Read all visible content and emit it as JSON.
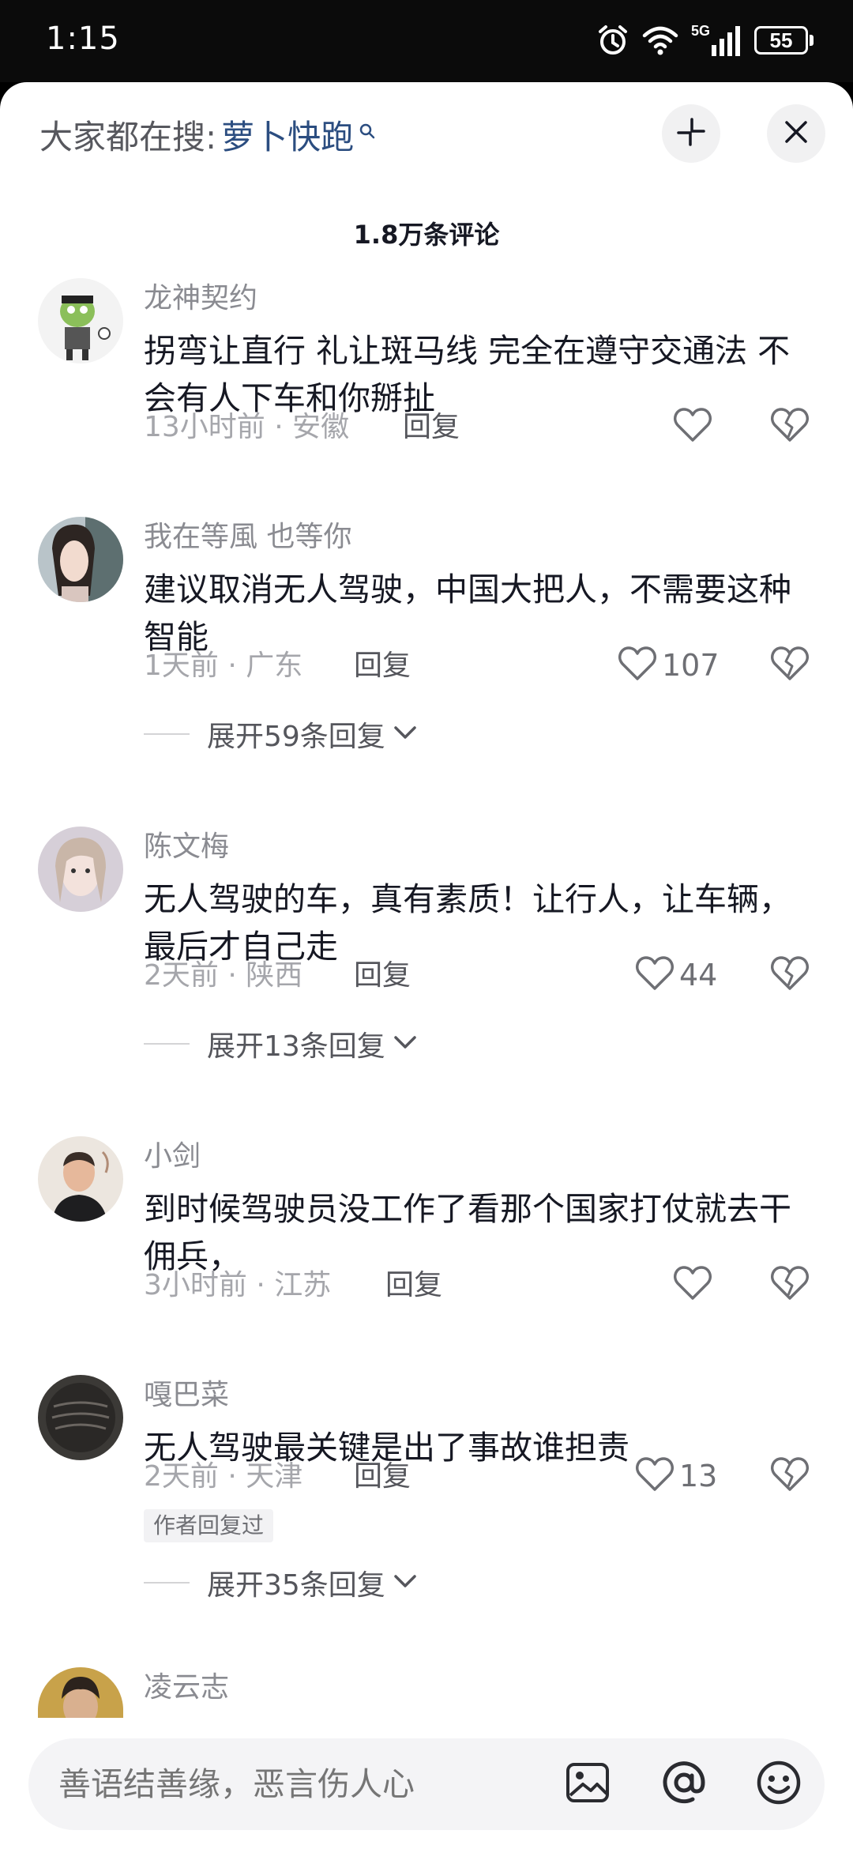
{
  "status": {
    "time": "1:15",
    "battery": "55",
    "network": "5G"
  },
  "search": {
    "prefix": "大家都在搜:",
    "term": "萝卜快跑"
  },
  "comment_count_label": "1.8万条评论",
  "comments": [
    {
      "user": "龙神契约",
      "text": "拐弯让直行  礼让斑马线  完全在遵守交通法    不会有人下车和你掰扯",
      "meta": "13小时前 · 安徽",
      "reply": "回复",
      "likes": ""
    },
    {
      "user": "我在等風 也等你",
      "text": "建议取消无人驾驶，中国大把人，不需要这种智能",
      "meta": "1天前 · 广东",
      "reply": "回复",
      "likes": "107",
      "expand": "展开59条回复"
    },
    {
      "user": "陈文梅",
      "text": "无人驾驶的车，真有素质！让行人，让车辆，最后才自己走",
      "meta": "2天前 · 陕西",
      "reply": "回复",
      "likes": "44",
      "expand": "展开13条回复"
    },
    {
      "user": "小剑",
      "text": "到时候驾驶员没工作了看那个国家打仗就去干佣兵，",
      "meta": "3小时前 · 江苏",
      "reply": "回复",
      "likes": ""
    },
    {
      "user": "嘎巴菜",
      "text": "无人驾驶最关键是出了事故谁担责",
      "meta": "2天前 · 天津",
      "reply": "回复",
      "likes": "13",
      "author_tag": "作者回复过",
      "expand": "展开35条回复"
    },
    {
      "user": "凌云志"
    }
  ],
  "input": {
    "placeholder": "善语结善缘，恶言伤人心"
  },
  "icons": [
    "alarm-icon",
    "wifi-icon",
    "signal-icon",
    "battery-icon",
    "search-icon",
    "minimize-icon",
    "close-icon",
    "heart-icon",
    "broken-heart-icon",
    "chevron-down-icon",
    "image-icon",
    "at-icon",
    "emoji-icon"
  ],
  "colors": {
    "link": "#2b4d80",
    "text": "#161823",
    "muted": "#8a8b91"
  }
}
